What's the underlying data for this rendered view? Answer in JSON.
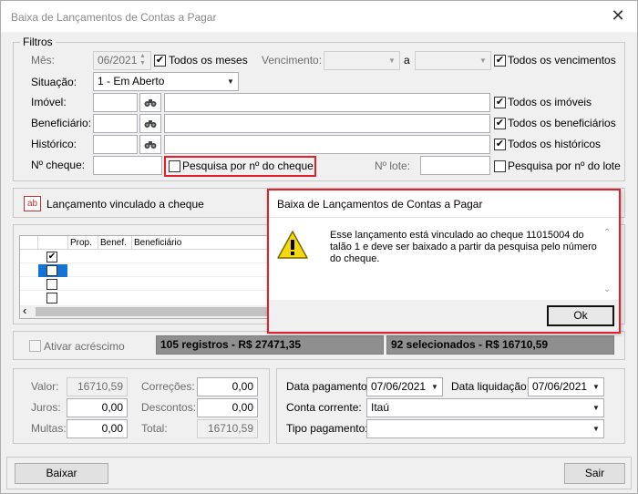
{
  "window": {
    "title": "Baixa de Lançamentos de Contas a Pagar",
    "close_glyph": "✕"
  },
  "filters": {
    "legend": "Filtros",
    "mes_label": "Mês:",
    "mes_value": "06/2021",
    "todos_meses_label": "Todos os meses",
    "vencimento_label": "Vencimento:",
    "a_label": "a",
    "todos_vencimentos_label": "Todos os vencimentos",
    "situacao_label": "Situação:",
    "situacao_value": "1 - Em Aberto",
    "imovel_label": "Imóvel:",
    "todos_imoveis_label": "Todos os imóveis",
    "beneficiario_label": "Beneficiário:",
    "todos_beneficiarios_label": "Todos os beneficiários",
    "historico_label": "Histórico:",
    "todos_historicos_label": "Todos os históricos",
    "cheque_label": "Nº cheque:",
    "pesquisa_cheque_label": "Pesquisa por nº do cheque",
    "lote_label": "Nº lote:",
    "pesquisa_lote_label": "Pesquisa por nº do lote",
    "check_glyph": "✔"
  },
  "vinculado": {
    "icon_text": "ab",
    "label": "Lançamento vinculado a cheque"
  },
  "grid": {
    "columns": [
      "Prop.",
      "Benef.",
      "Beneficiário"
    ],
    "rows": [
      {
        "checked": "✔"
      },
      {
        "checked": ""
      },
      {
        "checked": ""
      },
      {
        "checked": ""
      }
    ],
    "scroll_left": "‹",
    "scroll_down": "⌄",
    "scroll_up": "⌃"
  },
  "summary": {
    "ativar_label": "Ativar acréscimo",
    "registros": "105 registros - R$ 27471,35",
    "selecionados": "92 selecionados - R$ 16710,59"
  },
  "values": {
    "valor_label": "Valor:",
    "valor": "16710,59",
    "correcoes_label": "Correções:",
    "correcoes": "0,00",
    "juros_label": "Juros:",
    "juros": "0,00",
    "descontos_label": "Descontos:",
    "descontos": "0,00",
    "multas_label": "Multas:",
    "multas": "0,00",
    "total_label": "Total:",
    "total": "16710,59"
  },
  "payment": {
    "data_pagamento_label": "Data pagamento:",
    "data_pagamento": "07/06/2021",
    "data_liquidacao_label": "Data liquidação:",
    "data_liquidacao": "07/06/2021",
    "conta_label": "Conta corrente:",
    "conta": "Itaú",
    "tipo_label": "Tipo pagamento:",
    "tipo": ""
  },
  "footer": {
    "baixar": "Baixar",
    "sair": "Sair"
  },
  "dialog": {
    "title": "Baixa de Lançamentos de Contas a Pagar",
    "message": "Esse lançamento está vinculado ao cheque 11015004 do talão 1 e deve ser baixado a partir da pesquisa pelo número do cheque.",
    "ok": "Ok"
  },
  "colors": {
    "highlight_red": "#e0202a",
    "summary_gray": "#8f8f8f",
    "warning_yellow": "#f5d90f"
  }
}
